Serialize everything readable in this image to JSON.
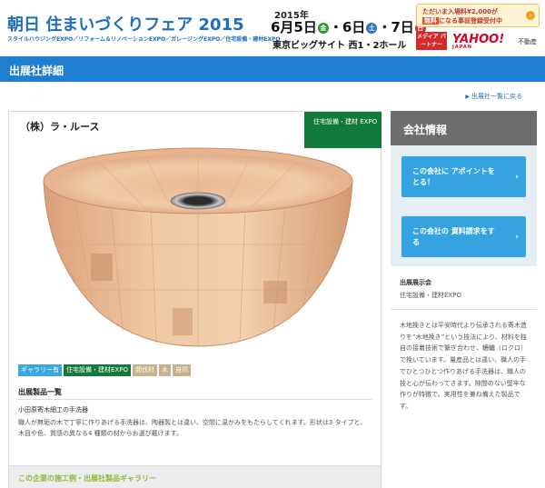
{
  "header": {
    "logo_title": "朝日 住まいづくりフェア 2015",
    "logo_subtitle": "スタイルハウジングEXPO／リフォーム＆リノベーションEXPO／ガレージングEXPO／住宅設備・建材EXPO",
    "year": "2015年",
    "date_6": "6月5日",
    "day_fri": "金",
    "date_7": "6日",
    "day_sat": "土",
    "date_8": "7日",
    "day_sun": "日",
    "date_sep": "・",
    "venue": "東京ビッグサイト 西1・2ホール",
    "banner_line1": "ただいま入場料¥2,000が",
    "banner_line2_prefix": "無料",
    "banner_line2_suffix": "になる事前登録受付中",
    "media_partner": "メディア パートナー",
    "yahoo": "YAHOO!",
    "yahoo_sub": "JAPAN",
    "fudosan": "不動産"
  },
  "title_bar": {
    "title": "出展社詳細"
  },
  "back_link": "出展社一覧に戻る",
  "main": {
    "company_name": "（株）ラ・ルース",
    "expo_tag": "住宅設備・建材 EXPO",
    "tags": [
      "ギャラリー有",
      "住宅設備・建材EXPO",
      "間伐材",
      "木",
      "自然"
    ],
    "section_heading": "出展製品一覧",
    "product_name": "小田原寄木細工の手洗器",
    "product_desc": "職人が無垢の木で丁寧に作りあげる手洗器は、陶器製とは違い、空間に温かみをもたらしてくれます。形状は3 タイプと、木目や色、質感の異なる4 種類の材からお選び戴けます。",
    "gallery_title": "この企業の施工例・出展社製品ギャラリー"
  },
  "sidebar": {
    "heading": "会社情報",
    "btn_appointment": "この会社に アポイントをとる！",
    "btn_catalog": "この会社の 資料請求をする",
    "exhibit_label": "出展展示会",
    "exhibit_value": "住宅設備・建材EXPO",
    "description": "木地挽きとは平安時代より伝承される寄木造りを”木地挽き”という技法により、材料を独自の接着技術で繋ぎ合わせ、轆轤（ロクロ）で挽いています。量産品とは違い、職人の手でひとつひとつ作りあげる手洗器は、職人の技と心が伝わってきます。隙間のない堅牢な作りが特徴で、実用性を兼ね備えた製品です。"
  },
  "colors": {
    "brand_blue": "#1e7fd0",
    "expo_green": "#127a3a",
    "button_blue": "#35a3e0",
    "gallery_green": "#8bb93a"
  }
}
